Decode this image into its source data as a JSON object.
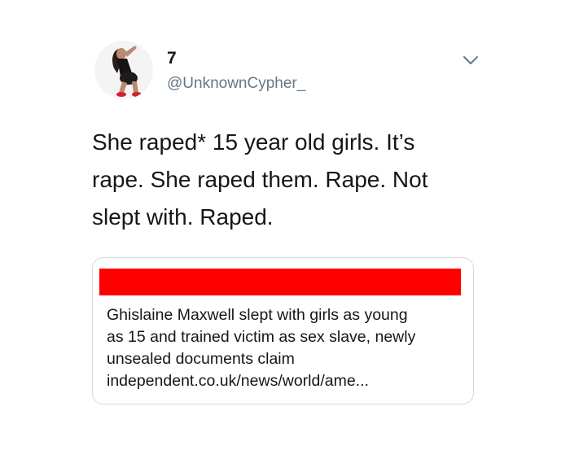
{
  "tweet": {
    "author": {
      "display_name": "7",
      "handle": "@UnknownCypher_",
      "avatar_icon": "profile-photo"
    },
    "menu_icon": "chevron-down-icon",
    "text_lines": [
      "She raped* 15 year old girls. It’s",
      "rape. She raped them. Rape. Not",
      "slept with. Raped."
    ],
    "link_card": {
      "redaction_color": "#fe0000",
      "title_lines": [
        "Ghislaine Maxwell slept with girls as young",
        "as 15 and trained victim as sex slave, newly",
        "unsealed documents claim"
      ],
      "url": "independent.co.uk/news/world/ame..."
    }
  },
  "colors": {
    "text": "#14171a",
    "secondary_text": "#657786",
    "border": "#d4d9de"
  }
}
